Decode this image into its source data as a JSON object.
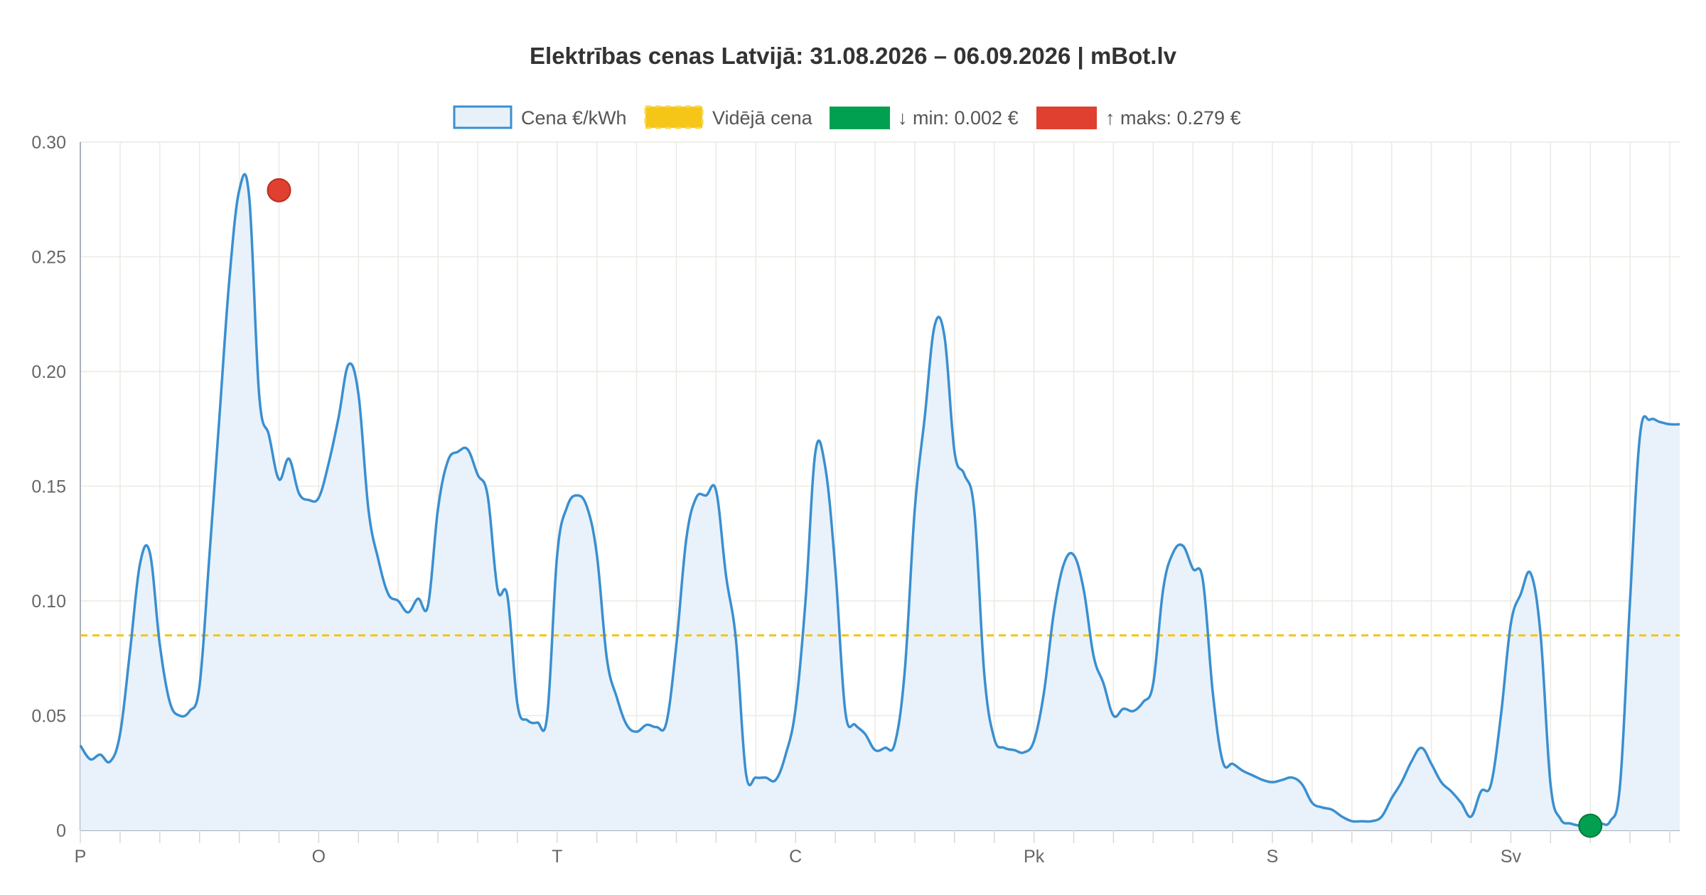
{
  "chart_data": {
    "type": "line",
    "title": "Elektrības cenas Latvijā: 31.08.2026 – 06.09.2026 | mBot.lv",
    "xlabel": "",
    "ylabel": "",
    "ylim": [
      0,
      0.3
    ],
    "y_ticks": [
      {
        "value": 0,
        "label": "0"
      },
      {
        "value": 0.05,
        "label": "0.05"
      },
      {
        "value": 0.1,
        "label": "0.10"
      },
      {
        "value": 0.15,
        "label": "0.15"
      },
      {
        "value": 0.2,
        "label": "0.20"
      },
      {
        "value": 0.25,
        "label": "0.25"
      },
      {
        "value": 0.3,
        "label": "0.30"
      }
    ],
    "x_day_labels": [
      "P",
      "O",
      "T",
      "C",
      "Pk",
      "S",
      "Sv"
    ],
    "grid": true,
    "legend_position": "top",
    "legend": [
      {
        "key": "price",
        "label": "Cena €/kWh",
        "color": "#3a8fd0",
        "fill": "#e8f1fa"
      },
      {
        "key": "avg",
        "label": "Vidējā cena",
        "color": "#f5c518"
      },
      {
        "key": "min",
        "label": "↓ min: 0.002 €",
        "color": "#00a050"
      },
      {
        "key": "max",
        "label": "↑ maks: 0.279 €",
        "color": "#e04030"
      }
    ],
    "average": 0.085,
    "min": {
      "hour_index": 152,
      "value": 0.002
    },
    "max": {
      "hour_index": 20,
      "value": 0.279
    },
    "series": [
      {
        "name": "Cena €/kWh",
        "values": [
          0.037,
          0.031,
          0.033,
          0.03,
          0.042,
          0.078,
          0.116,
          0.121,
          0.081,
          0.056,
          0.05,
          0.052,
          0.063,
          0.12,
          0.18,
          0.24,
          0.279,
          0.276,
          0.19,
          0.172,
          0.153,
          0.162,
          0.147,
          0.144,
          0.145,
          0.16,
          0.18,
          0.203,
          0.19,
          0.14,
          0.118,
          0.103,
          0.1,
          0.095,
          0.101,
          0.098,
          0.14,
          0.161,
          0.165,
          0.166,
          0.155,
          0.146,
          0.105,
          0.102,
          0.055,
          0.048,
          0.047,
          0.05,
          0.12,
          0.141,
          0.146,
          0.141,
          0.12,
          0.075,
          0.058,
          0.046,
          0.043,
          0.046,
          0.045,
          0.047,
          0.081,
          0.127,
          0.145,
          0.146,
          0.148,
          0.111,
          0.083,
          0.025,
          0.023,
          0.023,
          0.022,
          0.033,
          0.053,
          0.1,
          0.165,
          0.158,
          0.114,
          0.052,
          0.046,
          0.042,
          0.035,
          0.036,
          0.038,
          0.07,
          0.14,
          0.18,
          0.22,
          0.215,
          0.165,
          0.155,
          0.139,
          0.068,
          0.04,
          0.036,
          0.035,
          0.034,
          0.039,
          0.06,
          0.095,
          0.116,
          0.12,
          0.105,
          0.076,
          0.064,
          0.05,
          0.053,
          0.052,
          0.056,
          0.064,
          0.105,
          0.121,
          0.124,
          0.114,
          0.109,
          0.06,
          0.03,
          0.029,
          0.026,
          0.024,
          0.022,
          0.021,
          0.022,
          0.023,
          0.02,
          0.012,
          0.01,
          0.009,
          0.006,
          0.004,
          0.004,
          0.004,
          0.006,
          0.014,
          0.021,
          0.03,
          0.036,
          0.029,
          0.021,
          0.017,
          0.012,
          0.006,
          0.017,
          0.02,
          0.05,
          0.09,
          0.103,
          0.112,
          0.085,
          0.02,
          0.005,
          0.003,
          0.002,
          0.002,
          0.003,
          0.004,
          0.02,
          0.1,
          0.172,
          0.179,
          0.178,
          0.177,
          0.177
        ]
      }
    ]
  }
}
